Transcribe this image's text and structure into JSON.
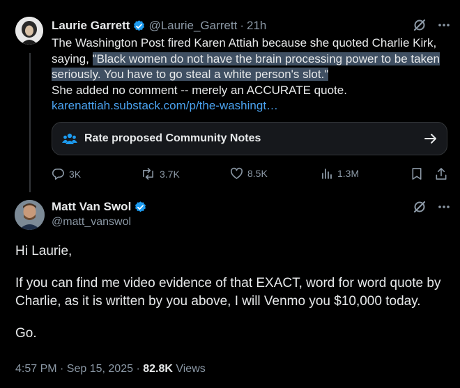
{
  "tweet1": {
    "name": "Laurie Garrett",
    "handle": "@Laurie_Garrett",
    "separator": "·",
    "time": "21h",
    "text_before": "The Washington Post fired Karen Attiah because she quoted Charlie Kirk, saying, ",
    "text_highlight": "\"Black women do not have the brain processing power to be taken seriously. You have to go steal a white person's slot.\"",
    "text_after": "She added no comment -- merely an ACCURATE quote.",
    "link": "karenattiah.substack.com/p/the-washingt…",
    "community_notes_label": "Rate proposed Community Notes",
    "stats": {
      "replies": "3K",
      "reposts": "3.7K",
      "likes": "8.5K",
      "views": "1.3M"
    }
  },
  "tweet2": {
    "name": "Matt Van Swol",
    "handle": "@matt_vanswol",
    "paragraphs": [
      "Hi Laurie,",
      "If you can find me video evidence of that EXACT, word for word quote by Charlie, as it is written by you above, I will Venmo you $10,000 today.",
      "Go."
    ],
    "timestamp": "4:57 PM · Sep 15, 2025 · ",
    "views_count": "82.8K",
    "views_label": " Views"
  },
  "icons": [
    "verified-badge-icon",
    "grok-icon",
    "more-icon",
    "community-icon",
    "arrow-right-icon",
    "reply-icon",
    "repost-icon",
    "like-icon",
    "views-icon",
    "bookmark-icon",
    "share-icon"
  ],
  "colors": {
    "background": "#000000",
    "text": "#e7e9ea",
    "muted": "#8b98a5",
    "link": "#4aa2ef",
    "verified": "#1d9bf0",
    "highlight": "#3f4f62"
  }
}
